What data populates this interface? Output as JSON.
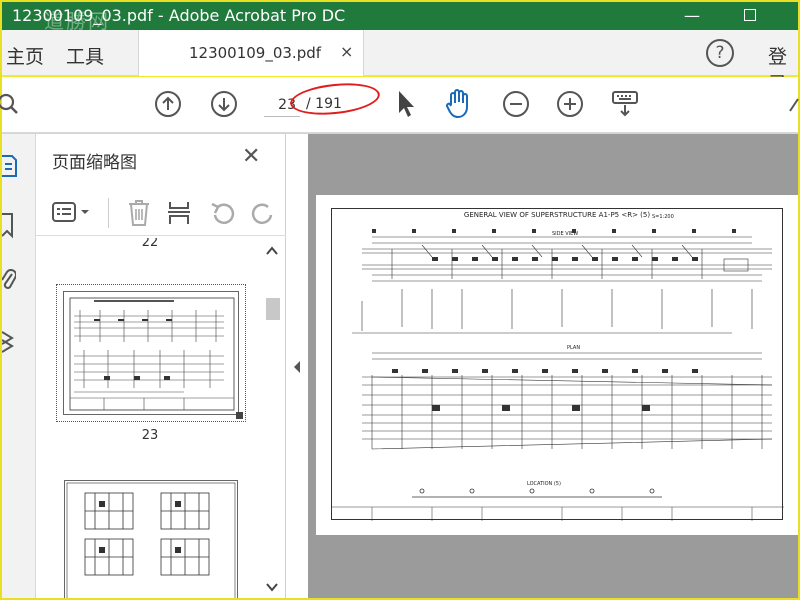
{
  "window": {
    "title": "12300109_03.pdf - Adobe Acrobat Pro DC",
    "watermark": "道勝网"
  },
  "menu": {
    "home_label": "主页",
    "tools_label": "工具",
    "login_label": "登录"
  },
  "tab": {
    "label": "12300109_03.pdf",
    "close_glyph": "×"
  },
  "toolbar": {
    "current_page": "23",
    "total_pages": "/ 191"
  },
  "thumbnails": {
    "panel_title": "页面缩略图",
    "close_glyph": "✕",
    "prev_label": "22",
    "selected_label": "23"
  },
  "pdf": {
    "title": "GENERAL VIEW OF SUPERSTRUCTURE A1-P5 <R> (5)",
    "scale": "S=1:200",
    "side_view": "SIDE VIEW",
    "plan": "PLAN",
    "location": "LOCATION (5)"
  },
  "colors": {
    "titlebar": "#1f7a3c",
    "frame": "#f0e92a",
    "accent_blue": "#1a6ab8",
    "annotation_red": "#e01c1c",
    "viewer_bg": "#9b9b9b"
  },
  "icons": [
    "search-icon",
    "arrow-up-circle-icon",
    "arrow-down-circle-icon",
    "pointer-icon",
    "hand-icon",
    "zoom-out-icon",
    "zoom-in-icon",
    "keyboard-icon",
    "help-icon",
    "page-icon",
    "bookmark-icon",
    "attachment-icon",
    "layers-icon",
    "list-icon",
    "trash-icon",
    "extract-icon",
    "undo-icon",
    "redo-icon"
  ]
}
